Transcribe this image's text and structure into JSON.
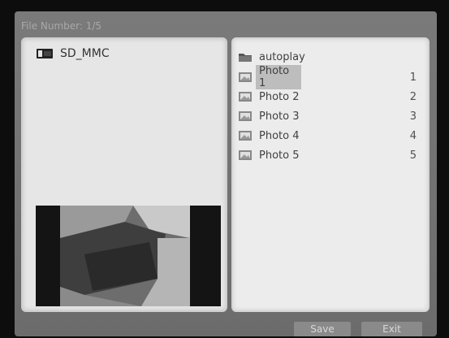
{
  "title": "File Number: 1/5",
  "left_panel": {
    "drive_label": "SD_MMC",
    "drive_icon": "sd-card-icon"
  },
  "right_panel": {
    "folder": {
      "label": "autoplay",
      "icon": "folder-icon"
    },
    "items": [
      {
        "label": "Photo 1",
        "num": "1",
        "icon": "photo-icon",
        "selected": true
      },
      {
        "label": "Photo 2",
        "num": "2",
        "icon": "photo-icon",
        "selected": false
      },
      {
        "label": "Photo 3",
        "num": "3",
        "icon": "photo-icon",
        "selected": false
      },
      {
        "label": "Photo 4",
        "num": "4",
        "icon": "photo-icon",
        "selected": false
      },
      {
        "label": "Photo 5",
        "num": "5",
        "icon": "photo-icon",
        "selected": false
      }
    ]
  },
  "status": {
    "left_text": "",
    "mid_text": ""
  },
  "buttons": {
    "save": "Save",
    "exit": "Exit"
  },
  "colors": {
    "panel_bg": "#e6e6e6",
    "selection": "#bdbdbd",
    "frame": "#0d0d0d"
  }
}
